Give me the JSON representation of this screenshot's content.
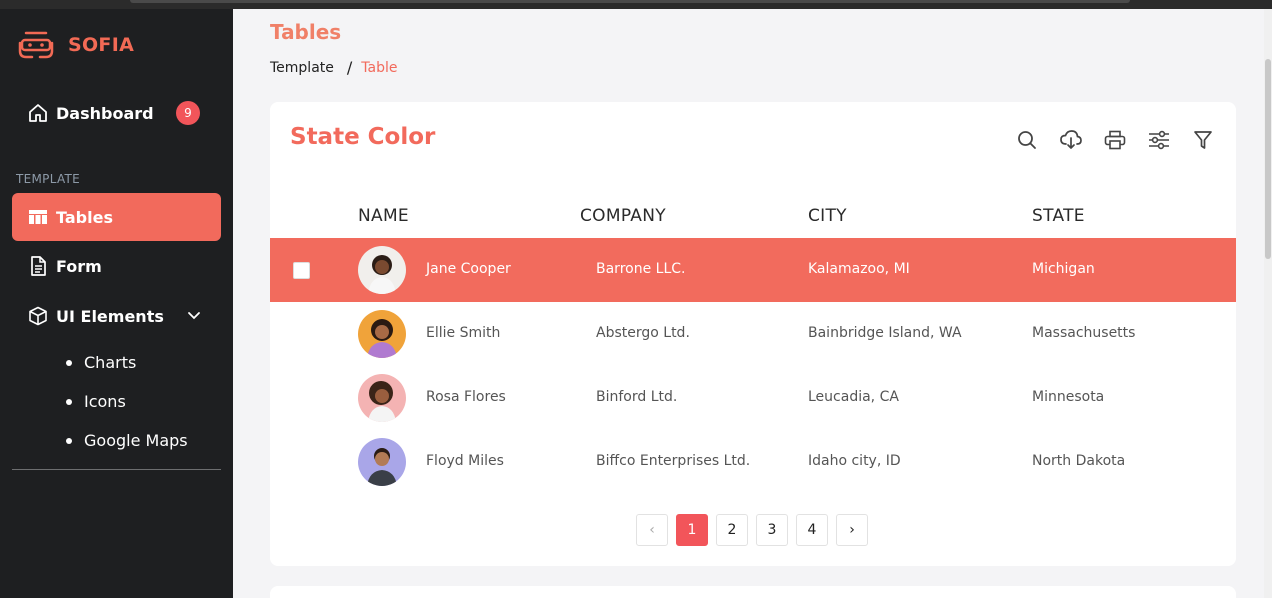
{
  "brand": {
    "name": "SOFIA",
    "accent": "#F26A5C"
  },
  "sidebar": {
    "dashboard": {
      "label": "Dashboard",
      "badge": "9"
    },
    "section_label": "TEMPLATE",
    "items": [
      {
        "label": "Tables",
        "active": true
      },
      {
        "label": "Form"
      },
      {
        "label": "UI Elements"
      }
    ],
    "sub_items": [
      "Charts",
      "Icons",
      "Google Maps"
    ]
  },
  "page": {
    "title": "Tables",
    "breadcrumb": {
      "parent": "Template",
      "separator": "/",
      "current": "Table"
    }
  },
  "card": {
    "title": "State Color",
    "tools": [
      "search-icon",
      "cloud-download-icon",
      "print-icon",
      "sliders-icon",
      "filter-icon"
    ]
  },
  "table": {
    "headers": [
      "NAME",
      "COMPANY",
      "CITY",
      "STATE"
    ],
    "rows": [
      {
        "name": "Jane Cooper",
        "company": "Barrone LLC.",
        "city": "Kalamazoo, MI",
        "state": "Michigan",
        "selected": true
      },
      {
        "name": "Ellie Smith",
        "company": "Abstergo Ltd.",
        "city": "Bainbridge Island, WA",
        "state": "Massachusetts"
      },
      {
        "name": "Rosa Flores",
        "company": "Binford Ltd.",
        "city": "Leucadia, CA",
        "state": "Minnesota"
      },
      {
        "name": "Floyd Miles",
        "company": "Biffco Enterprises Ltd.",
        "city": "Idaho city, ID",
        "state": "North Dakota"
      }
    ]
  },
  "pagination": {
    "prev": "‹",
    "pages": [
      "1",
      "2",
      "3",
      "4"
    ],
    "current": "1",
    "next": "›"
  }
}
